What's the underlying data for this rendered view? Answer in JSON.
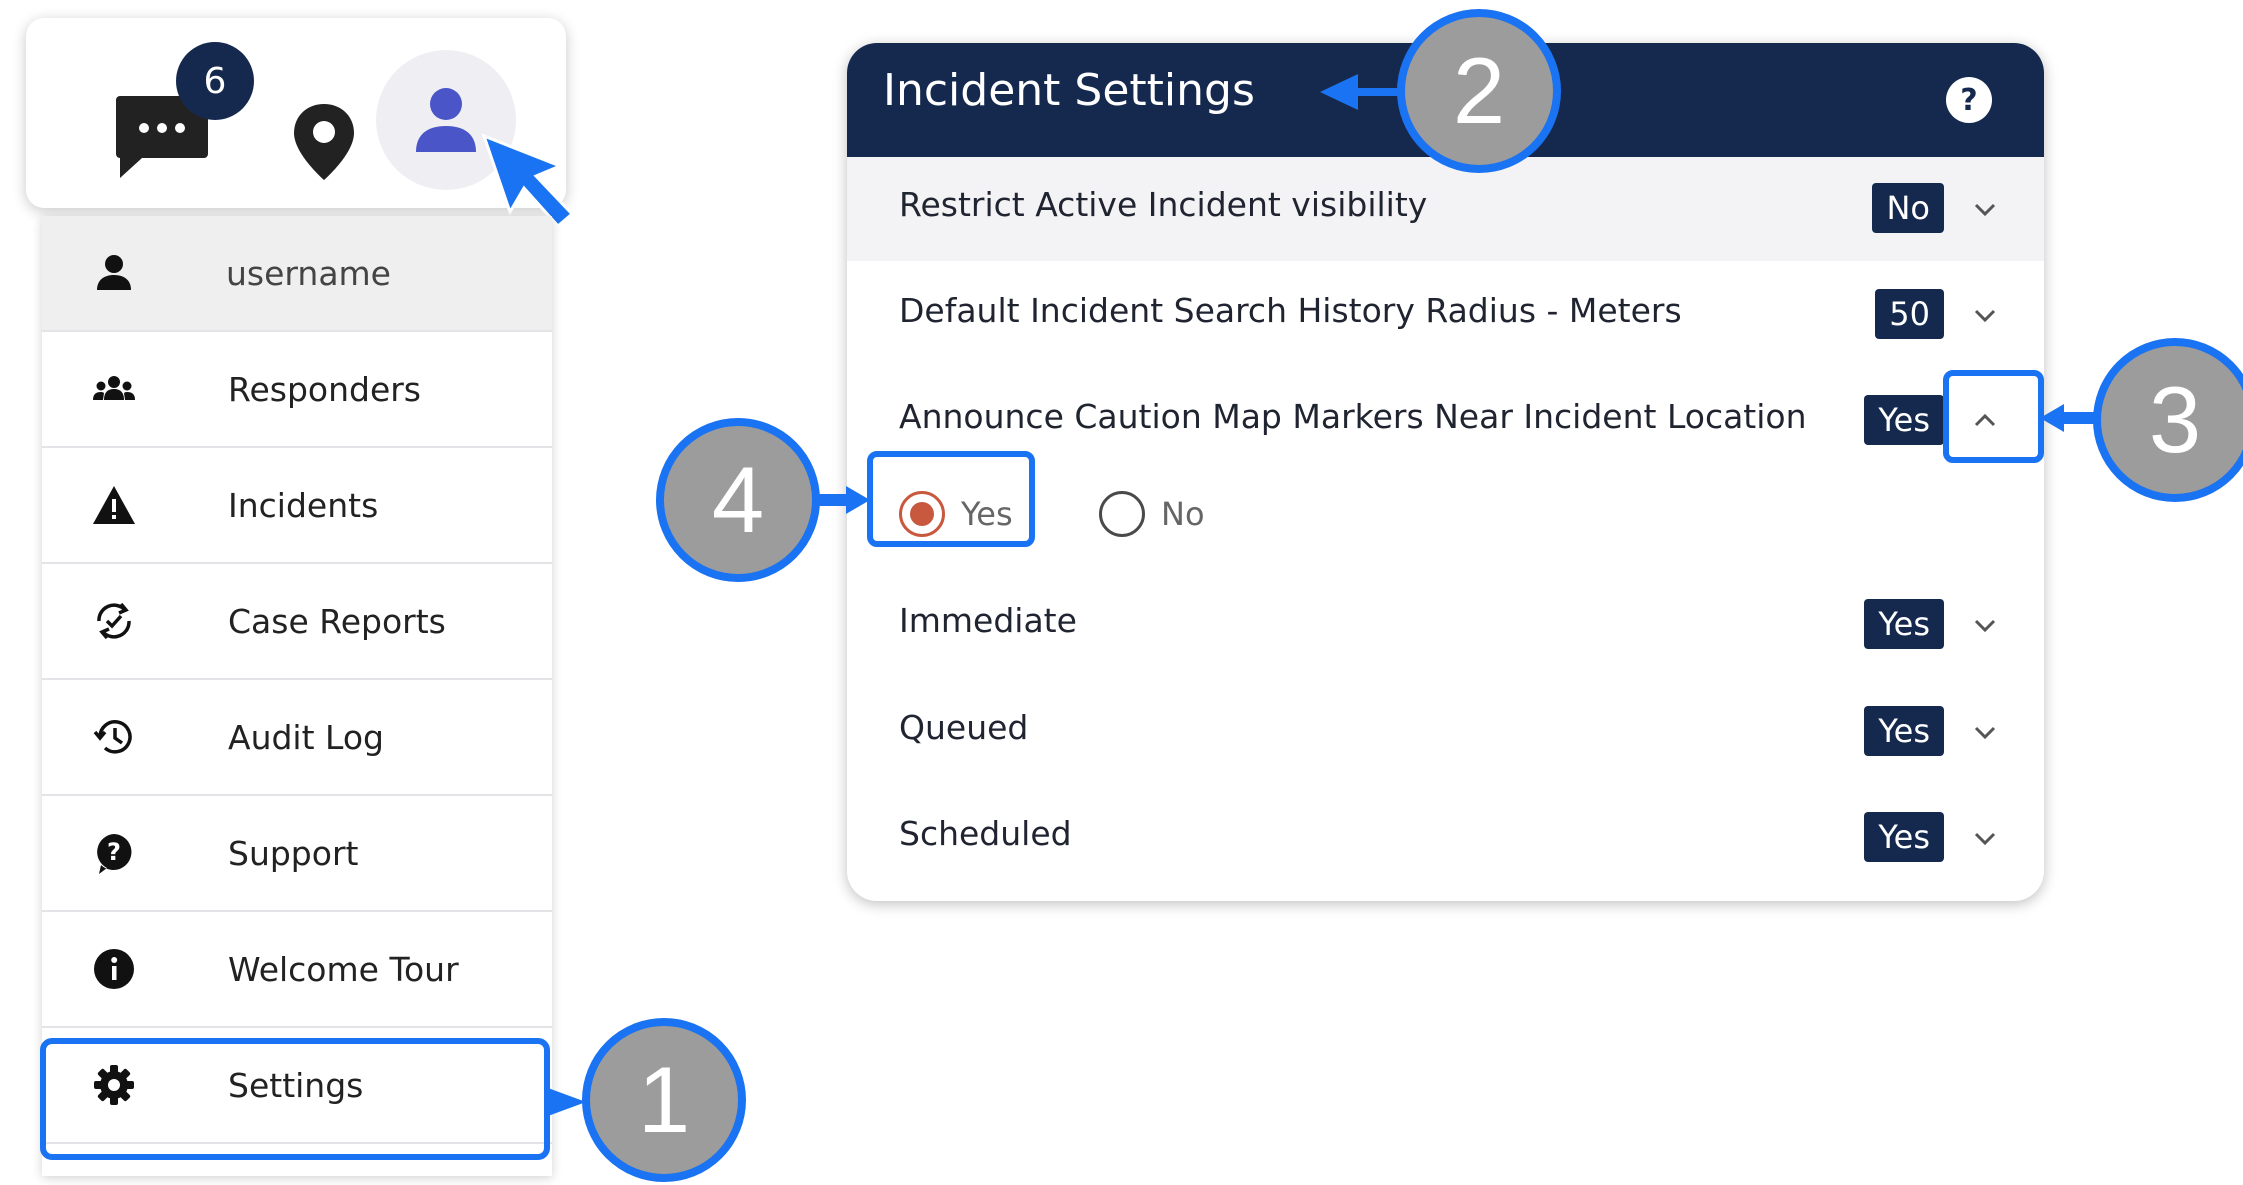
{
  "topbar": {
    "chat_badge_count": "6",
    "icons": [
      "chat-icon",
      "map-pin-icon",
      "user-avatar-icon"
    ]
  },
  "menu": {
    "items": [
      {
        "label": "username",
        "icon": "user-icon"
      },
      {
        "label": "Responders",
        "icon": "group-icon"
      },
      {
        "label": "Incidents",
        "icon": "warning-icon"
      },
      {
        "label": "Case Reports",
        "icon": "refresh-check-icon"
      },
      {
        "label": "Audit Log",
        "icon": "history-icon"
      },
      {
        "label": "Support",
        "icon": "help-bubble-icon"
      },
      {
        "label": "Welcome Tour",
        "icon": "info-icon"
      },
      {
        "label": "Settings",
        "icon": "gear-icon"
      }
    ]
  },
  "incident_settings": {
    "title": "Incident Settings",
    "rows": [
      {
        "label": "Restrict Active Incident visibility",
        "value": "No",
        "expanded": false
      },
      {
        "label": "Default Incident Search History Radius - Meters",
        "value": "50",
        "expanded": false
      },
      {
        "label": "Announce Caution Map Markers Near Incident Location",
        "value": "Yes",
        "expanded": true
      },
      {
        "label": "Immediate",
        "value": "Yes",
        "expanded": false
      },
      {
        "label": "Queued",
        "value": "Yes",
        "expanded": false
      },
      {
        "label": "Scheduled",
        "value": "Yes",
        "expanded": false
      }
    ],
    "radio_options": [
      {
        "label": "Yes",
        "checked": true
      },
      {
        "label": "No",
        "checked": false
      }
    ]
  },
  "steps": [
    "1",
    "2",
    "3",
    "4"
  ],
  "colors": {
    "navy": "#15294f",
    "highlight_blue": "#1a73f2",
    "step_gray": "#9c9c9c",
    "radio_accent": "#c8583e",
    "avatar_purple": "#4a55c8"
  }
}
